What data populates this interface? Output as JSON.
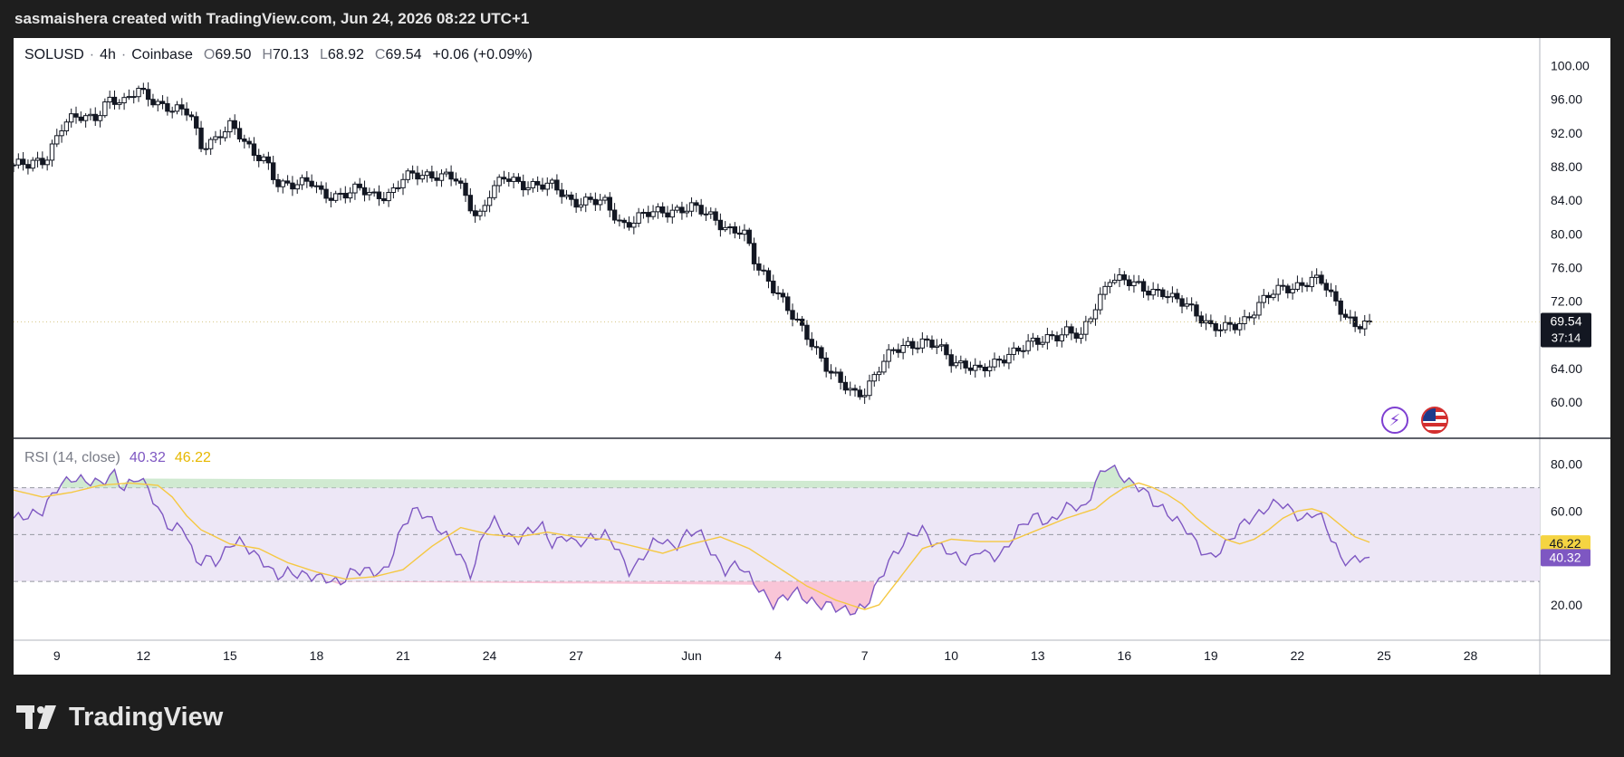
{
  "header": {
    "attribution": "sasmaishera created with TradingView.com, Jun 24, 2026 08:22 UTC+1"
  },
  "legend": {
    "symbol": "SOLUSD",
    "sep1": "·",
    "interval": "4h",
    "sep2": "·",
    "exchange": "Coinbase",
    "o_label": "O",
    "o_value": "69.50",
    "h_label": "H",
    "h_value": "70.13",
    "l_label": "L",
    "l_value": "68.92",
    "c_label": "C",
    "c_value": "69.54",
    "change": "+0.06 (+0.09%)"
  },
  "rsi_legend": {
    "title": "RSI (14, close)",
    "rsi_value": "40.32",
    "ma_value": "46.22"
  },
  "price_label": {
    "price": "69.54",
    "countdown": "37:14"
  },
  "footer": {
    "brand": "TradingView"
  },
  "colors": {
    "candle": "#131722",
    "rsi_line": "#7e57c2",
    "rsi_ma": "#f5c842",
    "rsi_band": "#ede7f6",
    "price_badge": "#131722",
    "ma_badge": "#f5d442",
    "rsi_badge": "#7e57c2"
  },
  "icons": [
    "lightning-icon",
    "us-flag-icon",
    "tradingview-logo-icon"
  ],
  "chart_data": [
    {
      "type": "candlestick",
      "title": "",
      "y_ticks": [
        60,
        64,
        68,
        72,
        76,
        80,
        84,
        88,
        92,
        96,
        100
      ],
      "y_tick_labels": [
        "60.00",
        "64.00",
        "68.00",
        "72.00",
        "76.00",
        "80.00",
        "84.00",
        "88.00",
        "92.00",
        "96.00",
        "100.00"
      ],
      "ylim": [
        57,
        102
      ],
      "x_ticks": [
        {
          "label": "9",
          "day": 9
        },
        {
          "label": "12",
          "day": 12
        },
        {
          "label": "15",
          "day": 15
        },
        {
          "label": "18",
          "day": 18
        },
        {
          "label": "21",
          "day": 21
        },
        {
          "label": "24",
          "day": 24
        },
        {
          "label": "27",
          "day": 27
        },
        {
          "label": "Jun",
          "day": 31
        },
        {
          "label": "4",
          "day": 34
        },
        {
          "label": "7",
          "day": 37
        },
        {
          "label": "10",
          "day": 40
        },
        {
          "label": "13",
          "day": 43
        },
        {
          "label": "16",
          "day": 46
        },
        {
          "label": "19",
          "day": 49
        },
        {
          "label": "22",
          "day": 52
        },
        {
          "label": "25",
          "day": 55
        },
        {
          "label": "28",
          "day": 58
        }
      ],
      "xlim_days": [
        7.5,
        60.4
      ],
      "last_price": 69.54,
      "close_path": [
        [
          7.5,
          88.2
        ],
        [
          8.0,
          88.0
        ],
        [
          8.6,
          89.0
        ],
        [
          9.2,
          93.0
        ],
        [
          9.8,
          93.8
        ],
        [
          10.3,
          94.0
        ],
        [
          10.8,
          96.0
        ],
        [
          11.3,
          95.2
        ],
        [
          11.8,
          97.5
        ],
        [
          12.2,
          96.5
        ],
        [
          12.6,
          95.0
        ],
        [
          13.0,
          94.5
        ],
        [
          13.6,
          95.0
        ],
        [
          14.0,
          90.5
        ],
        [
          14.5,
          90.8
        ],
        [
          15.0,
          93.0
        ],
        [
          15.4,
          92.0
        ],
        [
          15.8,
          89.5
        ],
        [
          16.2,
          88.5
        ],
        [
          16.6,
          86.0
        ],
        [
          17.2,
          86.2
        ],
        [
          17.8,
          86.0
        ],
        [
          18.2,
          84.5
        ],
        [
          18.8,
          84.8
        ],
        [
          19.4,
          85.2
        ],
        [
          20.0,
          84.5
        ],
        [
          20.6,
          85.0
        ],
        [
          21.0,
          86.5
        ],
        [
          21.6,
          87.0
        ],
        [
          22.2,
          87.2
        ],
        [
          22.8,
          86.5
        ],
        [
          23.2,
          84.0
        ],
        [
          23.6,
          82.0
        ],
        [
          24.0,
          85.0
        ],
        [
          24.5,
          86.5
        ],
        [
          25.0,
          86.0
        ],
        [
          25.6,
          86.0
        ],
        [
          26.2,
          85.5
        ],
        [
          26.8,
          84.0
        ],
        [
          27.4,
          84.0
        ],
        [
          28.0,
          83.5
        ],
        [
          28.6,
          81.2
        ],
        [
          29.2,
          82.0
        ],
        [
          29.8,
          82.5
        ],
        [
          30.4,
          83.0
        ],
        [
          31.0,
          83.0
        ],
        [
          31.4,
          82.5
        ],
        [
          31.8,
          82.0
        ],
        [
          32.3,
          80.5
        ],
        [
          32.8,
          80.0
        ],
        [
          33.2,
          76.5
        ],
        [
          33.6,
          75.0
        ],
        [
          34.0,
          73.0
        ],
        [
          34.3,
          71.0
        ],
        [
          34.6,
          69.5
        ],
        [
          35.0,
          68.0
        ],
        [
          35.4,
          66.0
        ],
        [
          35.8,
          63.5
        ],
        [
          36.2,
          62.0
        ],
        [
          36.6,
          61.0
        ],
        [
          37.0,
          61.5
        ],
        [
          37.5,
          64.0
        ],
        [
          38.0,
          66.0
        ],
        [
          38.5,
          67.0
        ],
        [
          39.0,
          67.2
        ],
        [
          39.5,
          66.5
        ],
        [
          40.0,
          65.0
        ],
        [
          40.6,
          64.5
        ],
        [
          41.0,
          63.5
        ],
        [
          41.5,
          64.5
        ],
        [
          42.0,
          66.0
        ],
        [
          42.5,
          66.5
        ],
        [
          43.0,
          67.0
        ],
        [
          43.5,
          68.0
        ],
        [
          44.0,
          68.5
        ],
        [
          44.5,
          67.5
        ],
        [
          45.0,
          71.5
        ],
        [
          45.5,
          75.0
        ],
        [
          45.8,
          74.5
        ],
        [
          46.2,
          74.0
        ],
        [
          46.8,
          73.5
        ],
        [
          47.3,
          73.2
        ],
        [
          47.7,
          72.0
        ],
        [
          48.2,
          71.5
        ],
        [
          48.6,
          70.5
        ],
        [
          49.0,
          69.0
        ],
        [
          49.4,
          68.5
        ],
        [
          49.8,
          69.0
        ],
        [
          50.2,
          70.0
        ],
        [
          50.6,
          71.5
        ],
        [
          51.0,
          72.5
        ],
        [
          51.5,
          73.5
        ],
        [
          52.0,
          74.0
        ],
        [
          52.5,
          74.5
        ],
        [
          52.9,
          74.0
        ],
        [
          53.3,
          72.0
        ],
        [
          53.7,
          70.5
        ],
        [
          54.0,
          69.0
        ],
        [
          54.3,
          69.2
        ],
        [
          54.6,
          69.54
        ]
      ]
    },
    {
      "type": "line",
      "title": "RSI (14, close)",
      "series": [
        {
          "name": "RSI",
          "last": 40.32
        },
        {
          "name": "MA",
          "last": 46.22
        }
      ],
      "y_ticks": [
        20,
        40,
        60,
        80
      ],
      "y_tick_labels": [
        "20.00",
        "",
        "60.00",
        "80.00"
      ],
      "bands": [
        30,
        50,
        70
      ],
      "ylim": [
        8,
        88
      ],
      "rsi_path": [
        [
          7.5,
          57
        ],
        [
          8.0,
          58
        ],
        [
          8.5,
          60
        ],
        [
          9.0,
          70
        ],
        [
          9.5,
          74
        ],
        [
          10.0,
          73
        ],
        [
          10.5,
          72
        ],
        [
          11.0,
          76
        ],
        [
          11.3,
          69
        ],
        [
          11.8,
          75
        ],
        [
          12.2,
          69
        ],
        [
          12.6,
          58
        ],
        [
          13.0,
          52
        ],
        [
          13.4,
          54
        ],
        [
          13.8,
          38
        ],
        [
          14.2,
          40
        ],
        [
          14.6,
          38
        ],
        [
          15.0,
          46
        ],
        [
          15.4,
          47
        ],
        [
          15.8,
          42
        ],
        [
          16.2,
          38
        ],
        [
          16.6,
          32
        ],
        [
          17.0,
          34
        ],
        [
          17.4,
          33
        ],
        [
          18.0,
          32
        ],
        [
          18.4,
          31
        ],
        [
          18.8,
          29
        ],
        [
          19.2,
          34
        ],
        [
          19.6,
          35
        ],
        [
          20.0,
          34
        ],
        [
          20.4,
          34
        ],
        [
          21.0,
          54
        ],
        [
          21.4,
          61
        ],
        [
          21.8,
          58
        ],
        [
          22.2,
          53
        ],
        [
          22.6,
          48
        ],
        [
          23.0,
          40
        ],
        [
          23.4,
          32
        ],
        [
          23.8,
          52
        ],
        [
          24.2,
          56
        ],
        [
          24.6,
          49
        ],
        [
          25.0,
          48
        ],
        [
          25.4,
          52
        ],
        [
          25.8,
          54
        ],
        [
          26.2,
          45
        ],
        [
          26.6,
          50
        ],
        [
          27.0,
          46
        ],
        [
          27.4,
          48
        ],
        [
          28.0,
          50
        ],
        [
          28.4,
          45
        ],
        [
          28.8,
          34
        ],
        [
          29.2,
          38
        ],
        [
          29.6,
          46
        ],
        [
          30.0,
          48
        ],
        [
          30.4,
          44
        ],
        [
          30.8,
          50
        ],
        [
          31.2,
          52
        ],
        [
          31.5,
          47
        ],
        [
          31.8,
          40
        ],
        [
          32.2,
          34
        ],
        [
          32.6,
          38
        ],
        [
          33.0,
          32
        ],
        [
          33.4,
          26
        ],
        [
          33.8,
          20
        ],
        [
          34.2,
          23
        ],
        [
          34.6,
          26
        ],
        [
          35.0,
          22
        ],
        [
          35.4,
          20
        ],
        [
          35.8,
          20
        ],
        [
          36.2,
          18
        ],
        [
          36.6,
          17
        ],
        [
          37.0,
          19
        ],
        [
          37.4,
          28
        ],
        [
          37.8,
          38
        ],
        [
          38.2,
          44
        ],
        [
          38.6,
          50
        ],
        [
          39.0,
          52
        ],
        [
          39.4,
          46
        ],
        [
          39.8,
          44
        ],
        [
          40.2,
          40
        ],
        [
          40.6,
          38
        ],
        [
          41.0,
          44
        ],
        [
          41.4,
          40
        ],
        [
          41.8,
          42
        ],
        [
          42.2,
          50
        ],
        [
          42.6,
          56
        ],
        [
          43.0,
          58
        ],
        [
          43.4,
          54
        ],
        [
          43.8,
          60
        ],
        [
          44.2,
          63
        ],
        [
          44.6,
          60
        ],
        [
          45.0,
          72
        ],
        [
          45.4,
          80
        ],
        [
          45.8,
          76
        ],
        [
          46.2,
          72
        ],
        [
          46.6,
          70
        ],
        [
          47.0,
          64
        ],
        [
          47.4,
          60
        ],
        [
          47.8,
          56
        ],
        [
          48.2,
          52
        ],
        [
          48.6,
          44
        ],
        [
          49.0,
          40
        ],
        [
          49.4,
          44
        ],
        [
          49.8,
          50
        ],
        [
          50.2,
          56
        ],
        [
          50.6,
          58
        ],
        [
          51.0,
          62
        ],
        [
          51.4,
          64
        ],
        [
          51.8,
          60
        ],
        [
          52.2,
          56
        ],
        [
          52.6,
          60
        ],
        [
          52.9,
          56
        ],
        [
          53.2,
          48
        ],
        [
          53.5,
          40
        ],
        [
          53.8,
          38
        ],
        [
          54.1,
          40
        ],
        [
          54.4,
          40.5
        ],
        [
          54.6,
          40.32
        ]
      ],
      "ma_path": [
        [
          7.5,
          69
        ],
        [
          8.5,
          66
        ],
        [
          9.5,
          68
        ],
        [
          10.5,
          71
        ],
        [
          11.5,
          72
        ],
        [
          12.5,
          71
        ],
        [
          13.0,
          66
        ],
        [
          13.5,
          58
        ],
        [
          14.0,
          52
        ],
        [
          15.0,
          46
        ],
        [
          16.0,
          44
        ],
        [
          17.0,
          38
        ],
        [
          18.0,
          34
        ],
        [
          19.0,
          31
        ],
        [
          20.0,
          32
        ],
        [
          21.0,
          35
        ],
        [
          22.0,
          45
        ],
        [
          23.0,
          53
        ],
        [
          24.0,
          50
        ],
        [
          25.0,
          49
        ],
        [
          26.0,
          51
        ],
        [
          27.0,
          49
        ],
        [
          28.0,
          48
        ],
        [
          29.0,
          45
        ],
        [
          30.0,
          42
        ],
        [
          31.0,
          46
        ],
        [
          32.0,
          49
        ],
        [
          33.0,
          44
        ],
        [
          34.0,
          36
        ],
        [
          35.0,
          28
        ],
        [
          36.0,
          22
        ],
        [
          37.0,
          18
        ],
        [
          37.5,
          20
        ],
        [
          38.0,
          28
        ],
        [
          38.5,
          36
        ],
        [
          39.0,
          44
        ],
        [
          40.0,
          48
        ],
        [
          41.0,
          47
        ],
        [
          42.0,
          47
        ],
        [
          43.0,
          52
        ],
        [
          44.0,
          57
        ],
        [
          45.0,
          61
        ],
        [
          45.5,
          66
        ],
        [
          46.0,
          70
        ],
        [
          46.5,
          72
        ],
        [
          47.0,
          70
        ],
        [
          47.5,
          67
        ],
        [
          48.0,
          63
        ],
        [
          48.5,
          57
        ],
        [
          49.0,
          52
        ],
        [
          49.5,
          48
        ],
        [
          50.0,
          46
        ],
        [
          50.5,
          48
        ],
        [
          51.0,
          52
        ],
        [
          51.5,
          57
        ],
        [
          52.0,
          60
        ],
        [
          52.5,
          61
        ],
        [
          53.0,
          59
        ],
        [
          53.5,
          54
        ],
        [
          54.0,
          49
        ],
        [
          54.6,
          46.22
        ]
      ]
    }
  ]
}
